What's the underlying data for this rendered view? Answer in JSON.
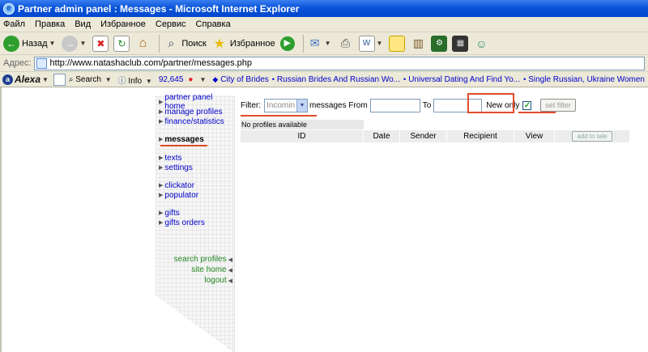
{
  "window": {
    "title": "Partner admin panel : Messages - Microsoft Internet Explorer"
  },
  "menu": [
    "Файл",
    "Правка",
    "Вид",
    "Избранное",
    "Сервис",
    "Справка"
  ],
  "toolbar": {
    "back_label": "Назад",
    "search_label": "Поиск",
    "favorites_label": "Избранное"
  },
  "address": {
    "label": "Адрес:",
    "url": "http://www.natashaclub.com/partner/messages.php"
  },
  "alexa": {
    "logo": "Alexa",
    "search_label": "Search",
    "info_label": "Info",
    "rank": "92,645",
    "links": [
      "City of Brides",
      "Russian Brides And Russian Wo...",
      "Universal Dating And Find Yo...",
      "Single Russian, Ukraine Women"
    ]
  },
  "sidebar": {
    "top_items": [
      "partner panel home",
      "manage profiles",
      "finance/statistics"
    ],
    "current": "messages",
    "group2": [
      "texts",
      "settings"
    ],
    "group3": [
      "clickator",
      "populator"
    ],
    "group4": [
      "gifts",
      "gifts orders"
    ],
    "bottom_items": [
      "search profiles",
      "site home",
      "logout"
    ]
  },
  "filter": {
    "label": "Filter:",
    "select_value": "Incomin",
    "messages_from": "messages From",
    "to_label": "To",
    "new_only_label": "New only",
    "new_only_checked": true,
    "set_filter_label": "set filter"
  },
  "table": {
    "empty_text": "No profiles available",
    "columns": [
      "ID",
      "Date",
      "Sender",
      "Recipient",
      "View"
    ],
    "action_button": "add to tale"
  },
  "colors": {
    "annotation": "#e14b2a",
    "link": "#0000cc",
    "xp_blue": "#0a54d8"
  }
}
